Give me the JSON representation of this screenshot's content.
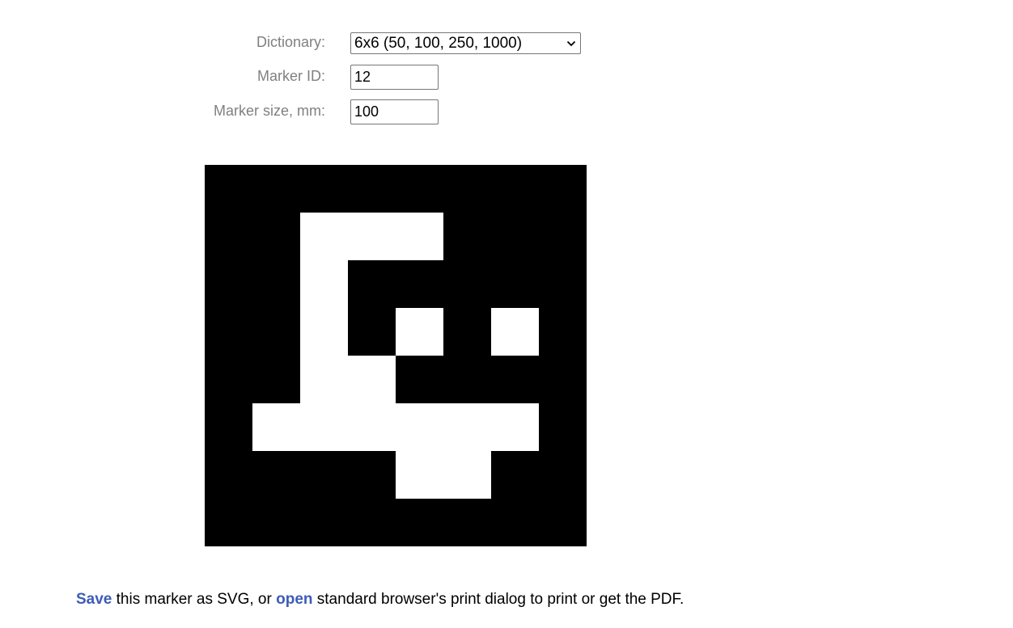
{
  "form": {
    "dictionary_label": "Dictionary:",
    "dictionary_value": "6x6 (50, 100, 250, 1000)",
    "marker_id_label": "Marker ID:",
    "marker_id_value": "12",
    "marker_size_label": "Marker size, mm:",
    "marker_size_value": "100"
  },
  "marker": {
    "grid_size": 8,
    "bits": [
      [
        0,
        0,
        0,
        0,
        0,
        0,
        0,
        0
      ],
      [
        0,
        0,
        1,
        1,
        1,
        0,
        0,
        0
      ],
      [
        0,
        0,
        1,
        0,
        0,
        0,
        0,
        0
      ],
      [
        0,
        0,
        1,
        0,
        1,
        0,
        1,
        0
      ],
      [
        0,
        0,
        1,
        1,
        0,
        0,
        0,
        0
      ],
      [
        0,
        1,
        1,
        1,
        1,
        1,
        1,
        0
      ],
      [
        0,
        0,
        0,
        0,
        1,
        1,
        0,
        0
      ],
      [
        0,
        0,
        0,
        0,
        0,
        0,
        0,
        0
      ]
    ],
    "colors": {
      "black": "#000000",
      "white": "#ffffff"
    }
  },
  "footer": {
    "save_link": "Save",
    "text_after_save": " this marker as SVG, or ",
    "open_link": "open",
    "text_after_open": " standard browser's print dialog to print or get the PDF."
  },
  "colors": {
    "link": "#3e5bb8",
    "label": "#808080"
  }
}
